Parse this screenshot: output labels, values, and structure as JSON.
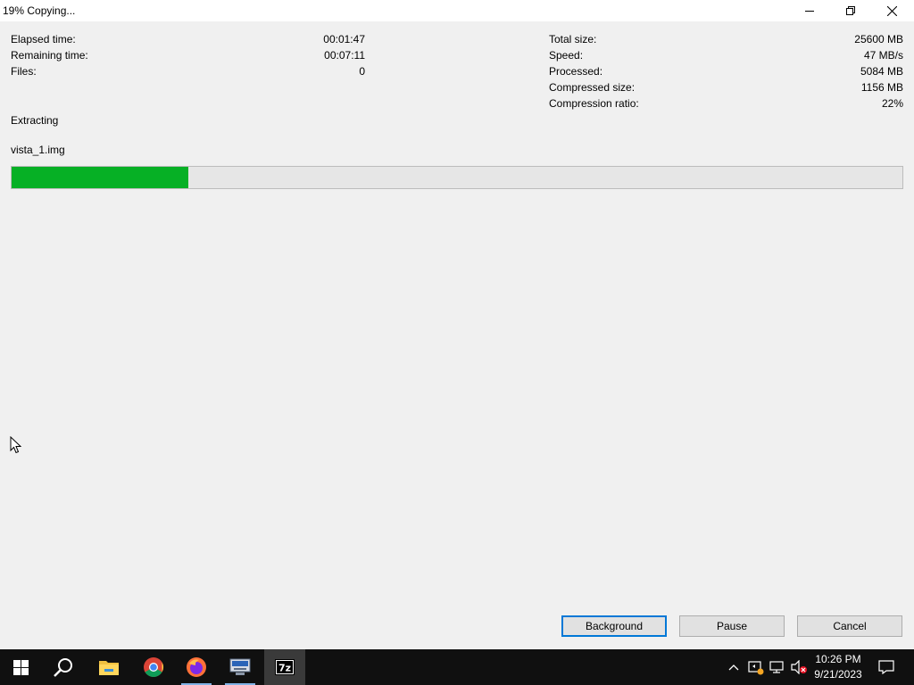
{
  "window": {
    "title": "19% Copying..."
  },
  "stats_left": {
    "elapsed_label": "Elapsed time:",
    "elapsed_value": "00:01:47",
    "remaining_label": "Remaining time:",
    "remaining_value": "00:07:11",
    "files_label": "Files:",
    "files_value": "0"
  },
  "stats_right": {
    "total_size_label": "Total size:",
    "total_size_value": "25600 MB",
    "speed_label": "Speed:",
    "speed_value": "47 MB/s",
    "processed_label": "Processed:",
    "processed_value": "5084 MB",
    "compressed_size_label": "Compressed size:",
    "compressed_size_value": "1156 MB",
    "compression_ratio_label": "Compression ratio:",
    "compression_ratio_value": "22%"
  },
  "operation": "Extracting",
  "current_file": "vista_1.img",
  "progress": {
    "percent": 19.8,
    "color": "#06b025"
  },
  "buttons": {
    "background": "Background",
    "pause": "Pause",
    "cancel": "Cancel"
  },
  "taskbar": {
    "apps": [
      "windows-start-icon",
      "search-icon",
      "file-explorer-icon",
      "chrome-icon",
      "firefox-icon",
      "network-app-icon",
      "7zip-icon"
    ],
    "time": "10:26 PM",
    "date": "9/21/2023"
  }
}
